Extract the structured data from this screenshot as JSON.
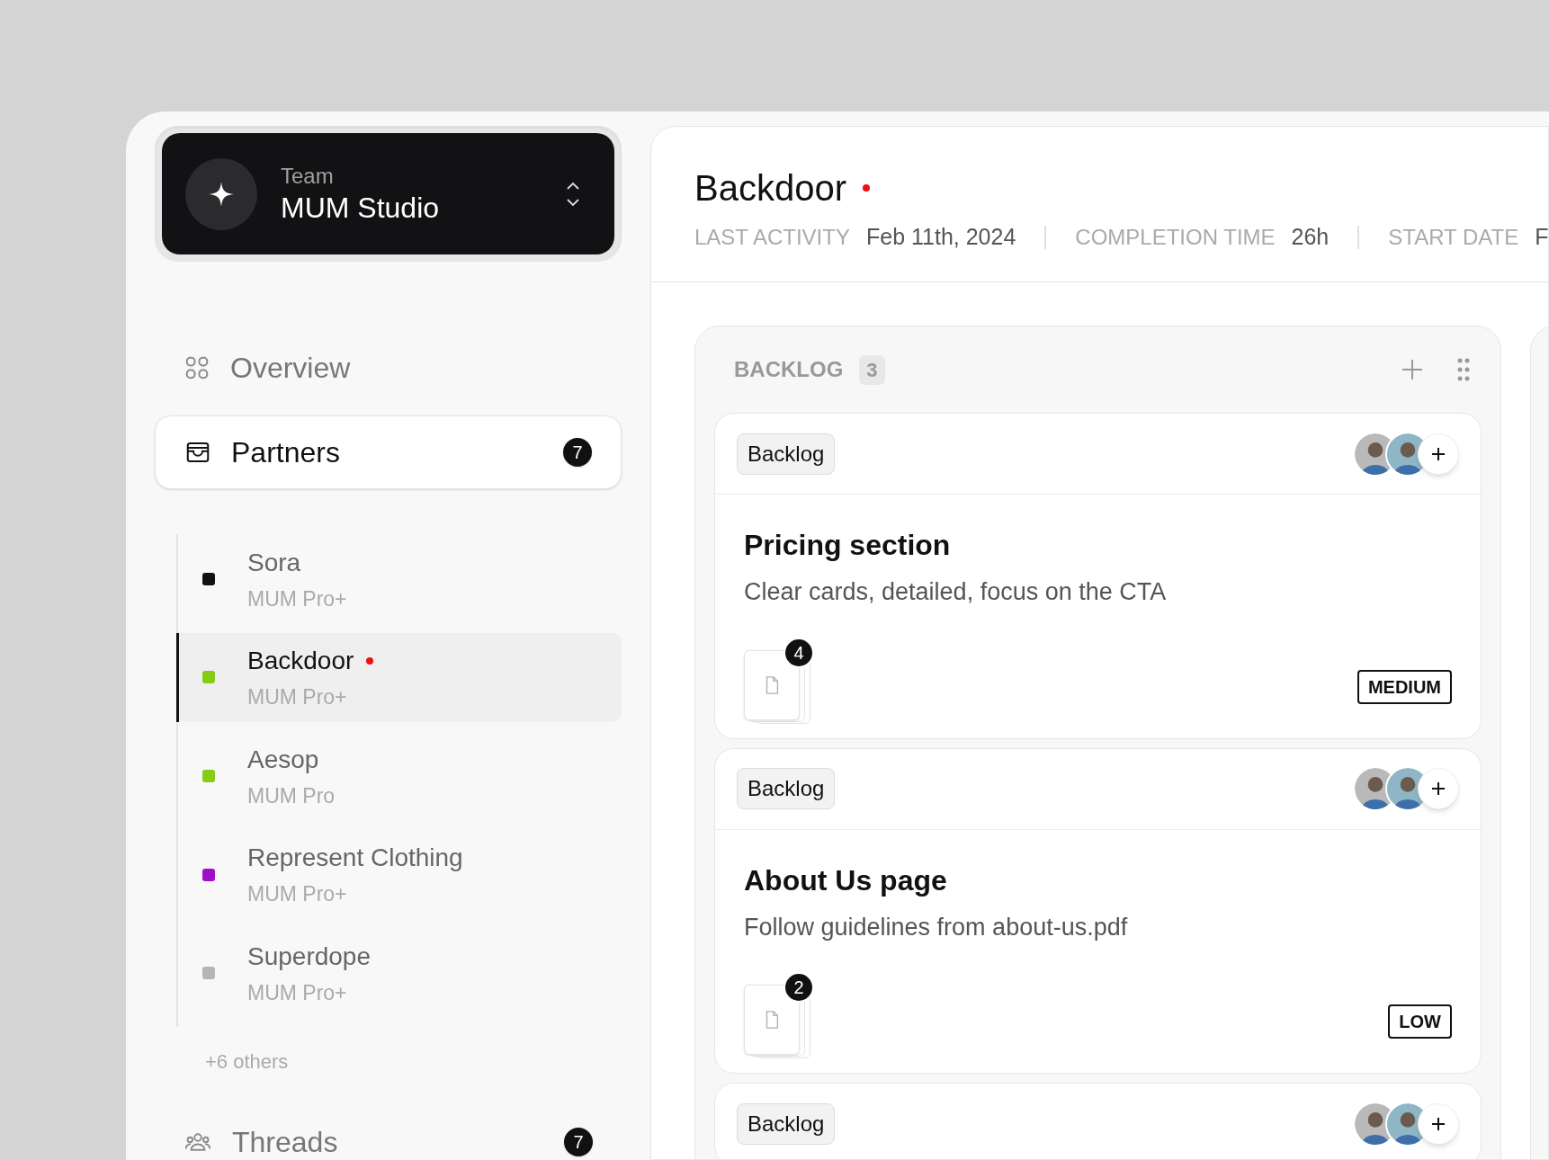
{
  "team": {
    "label": "Team",
    "name": "MUM Studio"
  },
  "nav": [
    {
      "label": "Overview",
      "selected": false
    },
    {
      "label": "Partners",
      "selected": true,
      "badge": "7",
      "expanded": true
    },
    {
      "label": "Threads",
      "selected": false,
      "badge": "7"
    }
  ],
  "partners": [
    {
      "name": "Sora",
      "plan": "MUM Pro+",
      "color": "#111111",
      "selected": false,
      "unread": false
    },
    {
      "name": "Backdoor",
      "plan": "MUM Pro+",
      "color": "#84cc16",
      "selected": true,
      "unread": true
    },
    {
      "name": "Aesop",
      "plan": "MUM Pro",
      "color": "#84cc16",
      "selected": false,
      "unread": false
    },
    {
      "name": "Represent Clothing",
      "plan": "MUM Pro+",
      "color": "#a00fc8",
      "selected": false,
      "unread": false
    },
    {
      "name": "Superdope",
      "plan": "MUM Pro+",
      "color": "#b5b5b5",
      "selected": false,
      "unread": false
    }
  ],
  "partners_more": "+6 others",
  "project": {
    "title": "Backdoor",
    "unread": true,
    "meta": [
      {
        "label": "LAST ACTIVITY",
        "value": "Feb 11th, 2024"
      },
      {
        "label": "COMPLETION TIME",
        "value": "26h"
      },
      {
        "label": "START DATE",
        "value": "F"
      }
    ]
  },
  "column": {
    "title": "BACKLOG",
    "count": "3",
    "cards": [
      {
        "tag": "Backlog",
        "title": "Pricing section",
        "description": "Clear cards, detailed, focus on the CTA",
        "attachments": "4",
        "priority": "MEDIUM"
      },
      {
        "tag": "Backlog",
        "title": "About Us page",
        "description": "Follow guidelines from about-us.pdf",
        "attachments": "2",
        "priority": "LOW"
      },
      {
        "tag": "Backlog"
      }
    ]
  }
}
